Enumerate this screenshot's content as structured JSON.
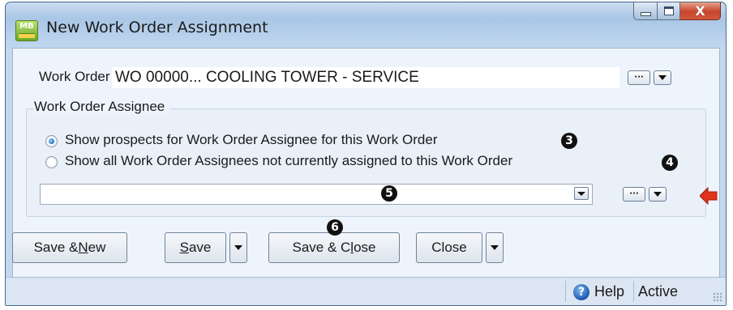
{
  "window": {
    "title": "New Work Order Assignment",
    "app_icon_label": "MB"
  },
  "caption_buttons": {
    "close_glyph": "X"
  },
  "work_order": {
    "label": "Work Order",
    "value": "WO 00000... COOLING TOWER - SERVICE",
    "lookup_glyph": "···"
  },
  "assignee_group": {
    "legend": "Work Order Assignee",
    "options": [
      {
        "label": "Show prospects for Work Order Assignee for this Work Order",
        "checked": true,
        "callout": "3"
      },
      {
        "label": "Show all Work Order Assignees not currently assigned to this Work Order",
        "checked": false,
        "callout": "4"
      }
    ],
    "combo_value": "",
    "combo_callout": "5",
    "lookup_glyph": "···"
  },
  "buttons": {
    "save_new": {
      "before": "Save & ",
      "mnemonic": "N",
      "after": "ew"
    },
    "save": {
      "before": "",
      "mnemonic": "S",
      "after": "ave"
    },
    "save_close": {
      "before": "Save & C",
      "mnemonic": "l",
      "after": "ose",
      "callout": "6"
    },
    "close": {
      "label": "Close"
    }
  },
  "status_bar": {
    "help": "Help",
    "state": "Active"
  },
  "colors": {
    "callout_arrow": "#e0321c",
    "radio_checked": "#1f6fc5"
  }
}
